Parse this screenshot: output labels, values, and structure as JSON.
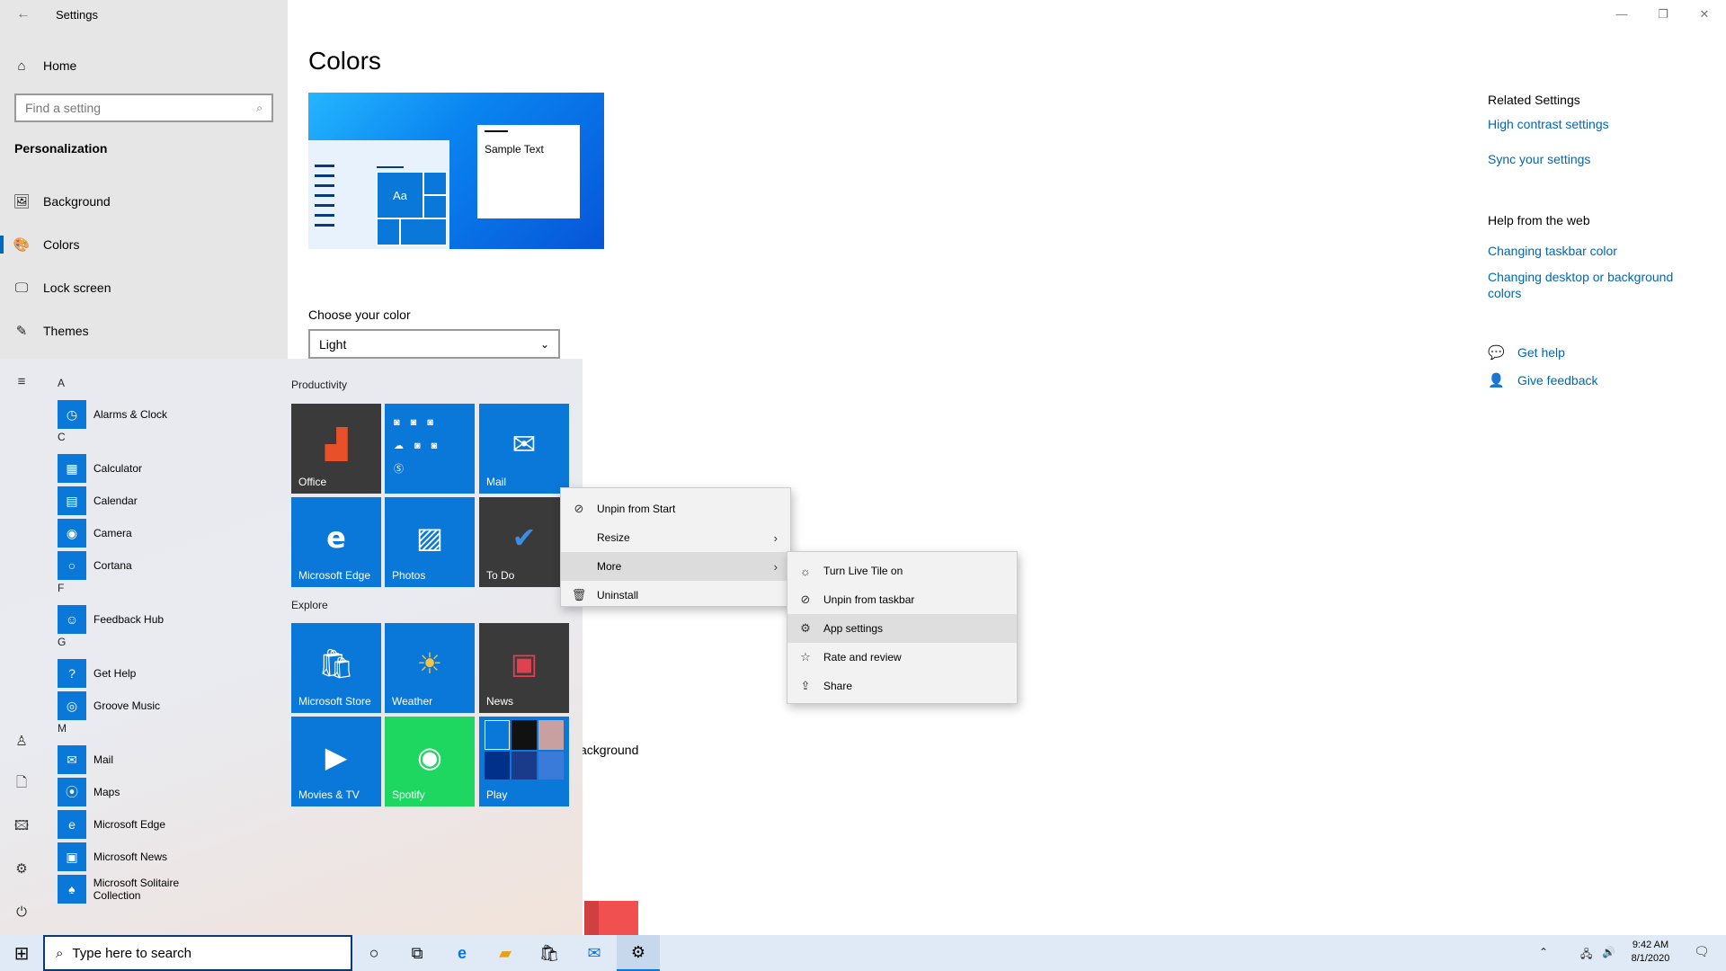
{
  "window": {
    "title": "Settings",
    "back_glyph": "←",
    "controls": {
      "minimize": "—",
      "maximize": "❐",
      "close": "✕"
    }
  },
  "nav": {
    "home": "Home",
    "search_placeholder": "Find a setting",
    "section": "Personalization",
    "items": [
      {
        "label": "Background",
        "icon": "image-icon",
        "glyph": "🖼"
      },
      {
        "label": "Colors",
        "icon": "palette-icon",
        "glyph": "🎨",
        "selected": true
      },
      {
        "label": "Lock screen",
        "icon": "lock-screen-icon",
        "glyph": "🖵"
      },
      {
        "label": "Themes",
        "icon": "themes-icon",
        "glyph": "✎"
      }
    ]
  },
  "main": {
    "title": "Colors",
    "preview_sample_text": "Sample Text",
    "preview_tile_label": "Aa",
    "choose_color_label": "Choose your color",
    "choose_color_value": "Light",
    "partial_text": "ackground"
  },
  "related": {
    "heading": "Related Settings",
    "links": [
      "High contrast settings",
      "Sync your settings"
    ],
    "help_heading": "Help from the web",
    "help_links": [
      "Changing taskbar color",
      "Changing desktop or background colors"
    ],
    "get_help": "Get help",
    "give_feedback": "Give feedback"
  },
  "start": {
    "apps": [
      {
        "letter": "A"
      },
      {
        "label": "Alarms & Clock",
        "glyph": "◷"
      },
      {
        "letter": "C"
      },
      {
        "label": "Calculator",
        "glyph": "▦"
      },
      {
        "label": "Calendar",
        "glyph": "▤"
      },
      {
        "label": "Camera",
        "glyph": "◉"
      },
      {
        "label": "Cortana",
        "glyph": "○"
      },
      {
        "letter": "F"
      },
      {
        "label": "Feedback Hub",
        "glyph": "☺"
      },
      {
        "letter": "G"
      },
      {
        "label": "Get Help",
        "glyph": "?"
      },
      {
        "label": "Groove Music",
        "glyph": "◎"
      },
      {
        "letter": "M"
      },
      {
        "label": "Mail",
        "glyph": "✉"
      },
      {
        "label": "Maps",
        "glyph": "⦿"
      },
      {
        "label": "Microsoft Edge",
        "glyph": "e"
      },
      {
        "label": "Microsoft News",
        "glyph": "▣"
      },
      {
        "label": "Microsoft Solitaire Collection",
        "glyph": "♠"
      }
    ],
    "group_productivity": "Productivity",
    "group_explore": "Explore",
    "tiles": {
      "office": "Office",
      "mail": "Mail",
      "edge": "Microsoft Edge",
      "photos": "Photos",
      "todo": "To Do",
      "store": "Microsoft Store",
      "weather": "Weather",
      "news": "News",
      "movies": "Movies & TV",
      "spotify": "Spotify",
      "play": "Play"
    }
  },
  "context_menu": {
    "items": [
      {
        "label": "Unpin from Start",
        "glyph": "⊘"
      },
      {
        "label": "Resize",
        "submenu": true
      },
      {
        "label": "More",
        "submenu": true,
        "active": true
      },
      {
        "label": "Uninstall",
        "glyph": "🗑"
      }
    ],
    "chevron": "›"
  },
  "submenu": {
    "items": [
      {
        "label": "Turn Live Tile on",
        "glyph": "☼"
      },
      {
        "label": "Unpin from taskbar",
        "glyph": "⊘"
      },
      {
        "label": "App settings",
        "glyph": "⚙",
        "hover": true
      },
      {
        "label": "Rate and review",
        "glyph": "☆"
      },
      {
        "label": "Share",
        "glyph": "⇪"
      }
    ]
  },
  "taskbar": {
    "search_placeholder": "Type here to search",
    "time": "9:42 AM",
    "date": "8/1/2020"
  }
}
